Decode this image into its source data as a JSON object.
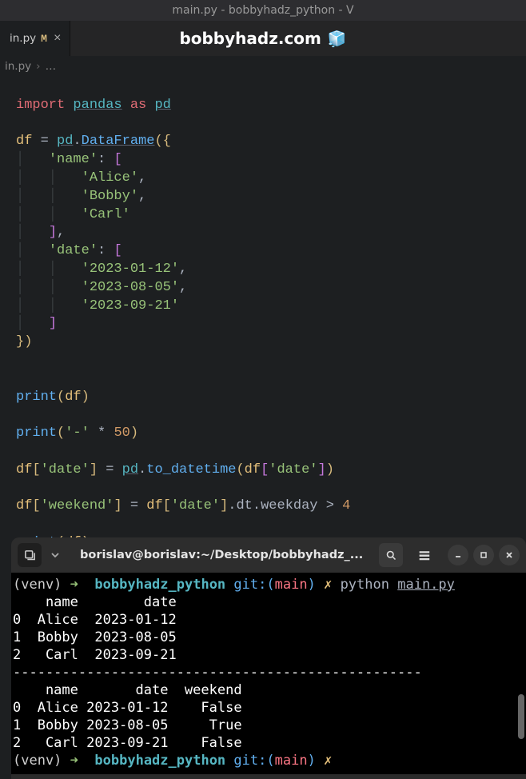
{
  "window": {
    "title": "main.py - bobbyhadz_python - V"
  },
  "tab": {
    "name": "in.py",
    "modified": "M"
  },
  "overlay": {
    "text": "bobbyhadz.com",
    "icon": "🧊"
  },
  "breadcrumb": {
    "file": "in.py",
    "more": "…"
  },
  "code": {
    "l1_import": "import",
    "l1_pandas": "pandas",
    "l1_as": "as",
    "l1_pd": "pd",
    "l3_df": "df",
    "l3_eq": "=",
    "l3_pd": "pd",
    "l3_dot": ".",
    "l3_fn": "DataFrame",
    "l3_open": "({",
    "l4_key": "'name'",
    "l4_colon": ":",
    "l4_open": "[",
    "l5": "'Alice'",
    "l6": "'Bobby'",
    "l7": "'Carl'",
    "l8_close": "]",
    "l9_key": "'date'",
    "l9_colon": ":",
    "l9_open": "[",
    "l10": "'2023-01-12'",
    "l11": "'2023-08-05'",
    "l12": "'2023-09-21'",
    "l13_close": "]",
    "l14_close": "})",
    "l17_print": "print",
    "l17_open": "(",
    "l17_arg": "df",
    "l17_close": ")",
    "l19_print": "print",
    "l19_open": "(",
    "l19_str": "'-'",
    "l19_star": "*",
    "l19_num": "50",
    "l19_close": ")",
    "l21_df": "df",
    "l21_idx": "'date'",
    "l21_eq": "=",
    "l21_pd": "pd",
    "l21_fn": "to_datetime",
    "l21_arg_df": "df",
    "l21_arg_idx": "'date'",
    "l23_df": "df",
    "l23_idx": "'weekend'",
    "l23_eq": "=",
    "l23_df2": "df",
    "l23_idx2": "'date'",
    "l23_dt": ".dt.weekday",
    "l23_gt": ">",
    "l23_num": "4",
    "l25_print": "print",
    "l25_arg": "df"
  },
  "terminal": {
    "title": "borislav@borislav:~/Desktop/bobbyhadz_...",
    "prompt": {
      "venv": "(venv)",
      "arrow": "➜",
      "dir": "bobbyhadz_python",
      "git": "git:(",
      "branch": "main",
      "git_close": ")",
      "flash": "✗"
    },
    "cmd": {
      "python": "python",
      "file": "main.py"
    },
    "out": {
      "hdr1": "    name        date",
      "r1": "0  Alice  2023-01-12",
      "r2": "1  Bobby  2023-08-05",
      "r3": "2   Carl  2023-09-21",
      "sep": "--------------------------------------------------",
      "hdr2": "    name       date  weekend",
      "r4": "0  Alice 2023-01-12    False",
      "r5": "1  Bobby 2023-08-05     True",
      "r6": "2   Carl 2023-09-21    False"
    }
  }
}
